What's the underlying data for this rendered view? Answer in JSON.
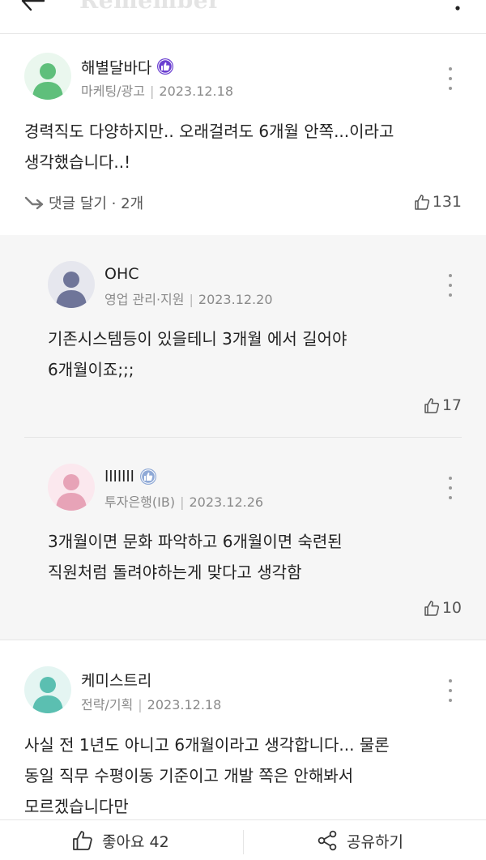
{
  "header": {
    "logo_text": "Remember",
    "back_icon": "arrow-left-icon",
    "more_icon": "more-vertical-icon"
  },
  "comments": [
    {
      "author": "해별달바다",
      "badge": "thumbs-up-badge-icon",
      "job": "마케팅/광고",
      "date": "2023.12.18",
      "text_lines": [
        "경력직도 다양하지만.. 오래걸려도 6개월 안쪽...이라고",
        "생각했습니다..!"
      ],
      "reply_label": "댓글 달기 · 2개",
      "likes": "131",
      "avatar_color": "#5fbf7b"
    },
    {
      "author": "OHC",
      "job": "영업 관리·지원",
      "date": "2023.12.20",
      "text_lines": [
        "기존시스템등이 있을테니 3개월 에서 길어야",
        "6개월이죠;;;"
      ],
      "likes": "17",
      "avatar_color": "#6f7599"
    },
    {
      "author": "lllllll",
      "badge": "thumbs-up-badge-icon",
      "job": "투자은행(IB)",
      "date": "2023.12.26",
      "text_lines": [
        "3개월이면 문화 파악하고 6개월이면 숙련된",
        "직원처럼 돌려야하는게 맞다고 생각함"
      ],
      "likes": "10",
      "avatar_color": "#e7a3b7"
    },
    {
      "author": "케미스트리",
      "job": "전략/기획",
      "date": "2023.12.18",
      "text_lines": [
        "사실 전 1년도 아니고 6개월이라고 생각합니다... 물론",
        "동일 직무 수평이동 기준이고 개발 쪽은 안해봐서",
        "모르겠습니다만"
      ],
      "avatar_color": "#5bbfb1"
    }
  ],
  "bottom_bar": {
    "like_label": "좋아요 42",
    "share_label": "공유하기"
  }
}
